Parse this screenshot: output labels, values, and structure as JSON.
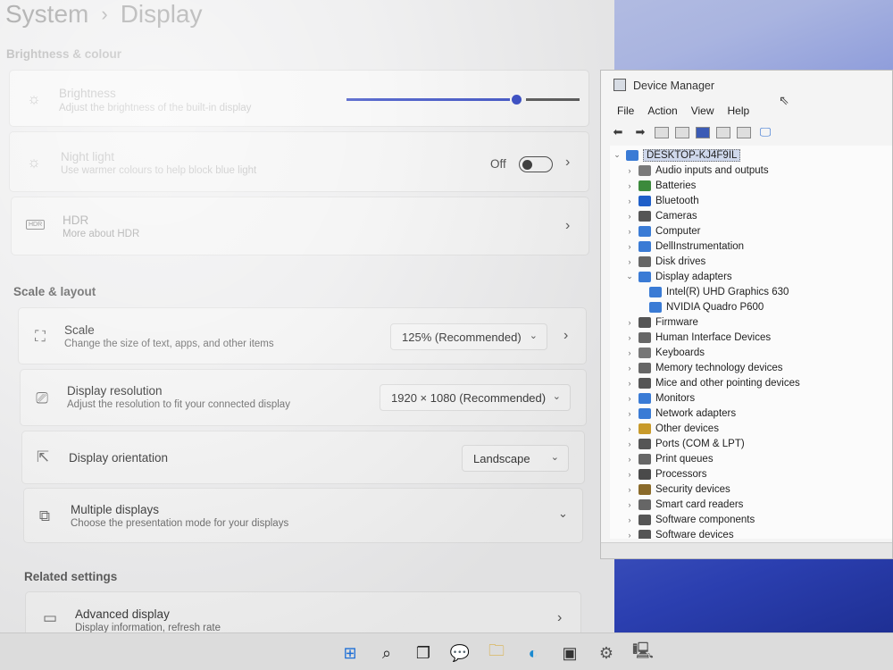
{
  "settings": {
    "breadcrumb": {
      "parent": "System",
      "current": "Display"
    },
    "brightness_colour": {
      "section_title": "Brightness & colour",
      "brightness": {
        "title": "Brightness",
        "subtitle": "Adjust the brightness of the built-in display",
        "level_percent": 75
      },
      "night_light": {
        "title": "Night light",
        "subtitle": "Use warmer colours to help block blue light",
        "state": "Off"
      },
      "hdr": {
        "title": "HDR",
        "subtitle": "More about HDR",
        "icon_label": "HDR"
      }
    },
    "scale_layout": {
      "section_title": "Scale & layout",
      "scale": {
        "title": "Scale",
        "subtitle": "Change the size of text, apps, and other items",
        "value": "125% (Recommended)"
      },
      "resolution": {
        "title": "Display resolution",
        "subtitle": "Adjust the resolution to fit your connected display",
        "value": "1920 × 1080 (Recommended)"
      },
      "orientation": {
        "title": "Display orientation",
        "value": "Landscape"
      },
      "multiple": {
        "title": "Multiple displays",
        "subtitle": "Choose the presentation mode for your displays"
      }
    },
    "related": {
      "section_title": "Related settings",
      "advanced": {
        "title": "Advanced display",
        "subtitle": "Display information, refresh rate"
      }
    }
  },
  "device_manager": {
    "title": "Device Manager",
    "menu": [
      "File",
      "Action",
      "View",
      "Help"
    ],
    "root": "DESKTOP-KJ4F9IL",
    "categories": [
      {
        "label": "Audio inputs and outputs",
        "icon": "speaker-icon",
        "color": "#7a7a7a"
      },
      {
        "label": "Batteries",
        "icon": "battery-icon",
        "color": "#3c8a3c"
      },
      {
        "label": "Bluetooth",
        "icon": "bluetooth-icon",
        "color": "#1f5fc8"
      },
      {
        "label": "Cameras",
        "icon": "camera-icon",
        "color": "#555555"
      },
      {
        "label": "Computer",
        "icon": "computer-icon",
        "color": "#3a7bd5"
      },
      {
        "label": "DellInstrumentation",
        "icon": "monitor-icon",
        "color": "#3a7bd5"
      },
      {
        "label": "Disk drives",
        "icon": "disk-icon",
        "color": "#666666"
      },
      {
        "label": "Display adapters",
        "icon": "display-adapter-icon",
        "color": "#3a7bd5",
        "expanded": true,
        "children": [
          "Intel(R) UHD Graphics 630",
          "NVIDIA Quadro P600"
        ]
      },
      {
        "label": "Firmware",
        "icon": "firmware-icon",
        "color": "#555555"
      },
      {
        "label": "Human Interface Devices",
        "icon": "hid-icon",
        "color": "#666666"
      },
      {
        "label": "Keyboards",
        "icon": "keyboard-icon",
        "color": "#777777"
      },
      {
        "label": "Memory technology devices",
        "icon": "memory-icon",
        "color": "#666666"
      },
      {
        "label": "Mice and other pointing devices",
        "icon": "mouse-icon",
        "color": "#555555"
      },
      {
        "label": "Monitors",
        "icon": "monitor-icon",
        "color": "#3a7bd5"
      },
      {
        "label": "Network adapters",
        "icon": "network-icon",
        "color": "#3a7bd5"
      },
      {
        "label": "Other devices",
        "icon": "other-devices-icon",
        "color": "#c89a2a"
      },
      {
        "label": "Ports (COM & LPT)",
        "icon": "port-icon",
        "color": "#555555"
      },
      {
        "label": "Print queues",
        "icon": "printer-icon",
        "color": "#666666"
      },
      {
        "label": "Processors",
        "icon": "processor-icon",
        "color": "#4a4a4a"
      },
      {
        "label": "Security devices",
        "icon": "security-icon",
        "color": "#8a6a2a"
      },
      {
        "label": "Smart card readers",
        "icon": "smartcard-icon",
        "color": "#666666"
      },
      {
        "label": "Software components",
        "icon": "software-icon",
        "color": "#555555"
      },
      {
        "label": "Software devices",
        "icon": "software-icon",
        "color": "#555555"
      }
    ]
  },
  "taskbar": {
    "items": [
      "start-icon",
      "search-icon",
      "task-view-icon",
      "chat-icon",
      "file-explorer-icon",
      "edge-icon",
      "store-icon",
      "settings-icon",
      "device-manager-icon"
    ]
  }
}
